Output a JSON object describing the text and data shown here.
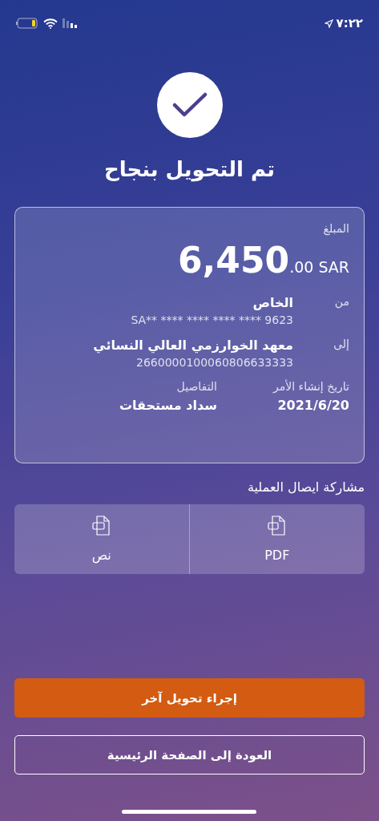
{
  "status_bar": {
    "time": "٧:٢٢"
  },
  "title": "تم التحويل بنجاح",
  "card": {
    "amount_label": "المبلغ",
    "amount_whole": "6,450",
    "amount_fraction": ".00 SAR",
    "parties": [
      {
        "label": "من",
        "name": "الخاص",
        "account": "SA** **** **** **** **** 9623"
      },
      {
        "label": "إلى",
        "name": "معهد الخوارزمي العالي النسائي",
        "account": "2660000100060806633333"
      }
    ],
    "meta": [
      {
        "label": "تاريخ إنشاء الأمر",
        "value": "2021/6/20"
      },
      {
        "label": "التفاصيل",
        "value": "سداد مستحقات"
      }
    ]
  },
  "share": {
    "title": "مشاركة ايصال العملية",
    "options": [
      {
        "kind": "pdf",
        "label": "PDF"
      },
      {
        "kind": "txt",
        "label": "نص"
      }
    ]
  },
  "buttons": [
    {
      "kind": "primary",
      "label": "إجراء تحويل آخر"
    },
    {
      "kind": "outline",
      "label": "العودة إلى الصفحة الرئيسية"
    }
  ]
}
